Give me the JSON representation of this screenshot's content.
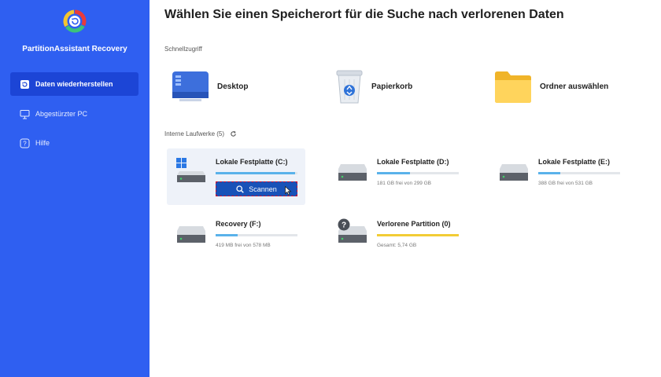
{
  "sidebar": {
    "app_name": "PartitionAssistant Recovery",
    "items": [
      {
        "label": "Daten wiederherstellen",
        "icon": "restore-icon",
        "active": true
      },
      {
        "label": "Abgestürzter PC",
        "icon": "monitor-icon",
        "active": false
      },
      {
        "label": "Hilfe",
        "icon": "help-icon",
        "active": false
      }
    ]
  },
  "main": {
    "title": "Wählen Sie einen Speicherort für die Suche nach verlorenen Daten",
    "quick_access": {
      "label": "Schnellzugriff",
      "items": [
        {
          "label": "Desktop",
          "icon": "desktop-icon"
        },
        {
          "label": "Papierkorb",
          "icon": "recycle-bin-icon"
        },
        {
          "label": "Ordner auswählen",
          "icon": "folder-icon"
        }
      ]
    },
    "drives_section": {
      "label": "Interne Laufwerke (5)",
      "refresh_icon": "refresh-icon"
    },
    "drives": [
      {
        "name": "Lokale Festplatte (C:)",
        "fill": 0.97,
        "info": "",
        "button": "Scannen",
        "selected": true
      },
      {
        "name": "Lokale Festplatte (D:)",
        "fill": 0.4,
        "info": "181 GB frei von 299 GB",
        "selected": false
      },
      {
        "name": "Lokale Festplatte (E:)",
        "fill": 0.27,
        "info": "388 GB frei von 531 GB",
        "selected": false
      },
      {
        "name": "Recovery (F:)",
        "fill": 0.27,
        "info": "419 MB frei von 578 MB",
        "selected": false
      },
      {
        "name": "Verlorene Partition (0)",
        "fill": 1.0,
        "info": "Gesamt: 5,74 GB",
        "selected": false
      }
    ],
    "colors": {
      "sidebar": "#2f5ff1",
      "active_nav": "#1c45d6",
      "bar_fill": "#5ab2ea",
      "bar_lost": "#f2cc35",
      "scan_button": "#1852b8"
    }
  }
}
